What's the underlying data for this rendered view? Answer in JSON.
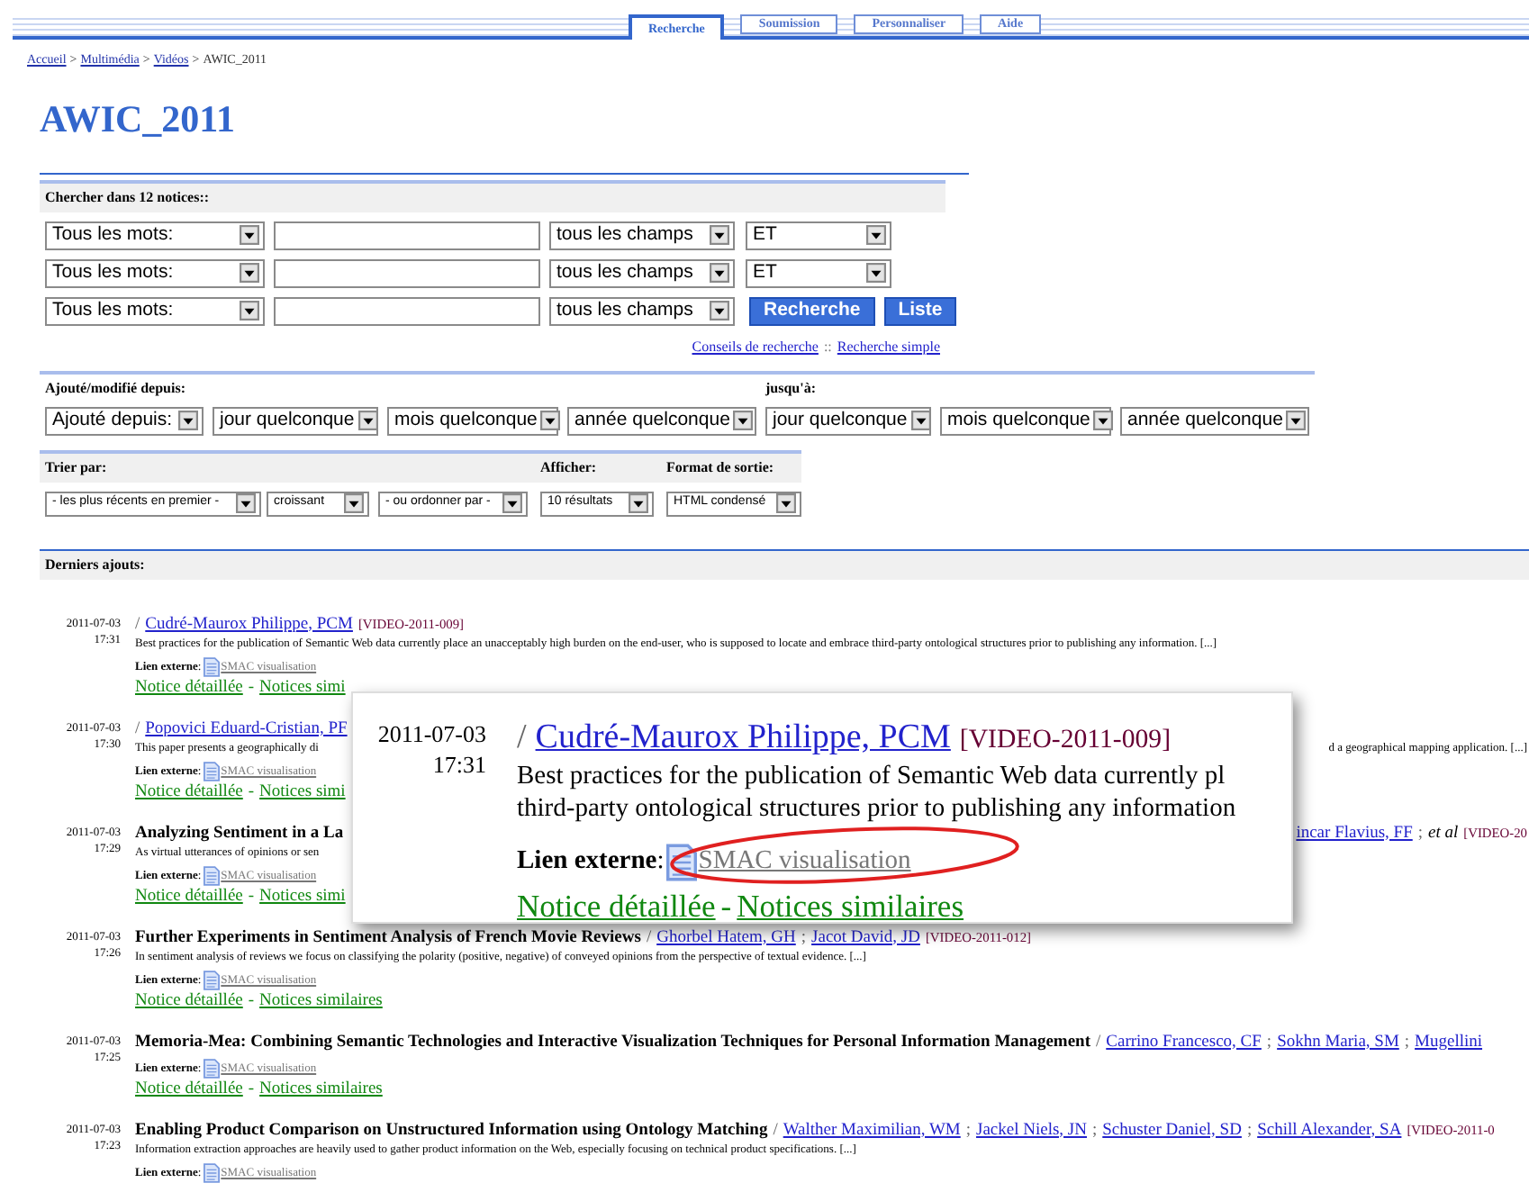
{
  "tabs": [
    {
      "label": "Recherche",
      "selected": true
    },
    {
      "label": "Soumission",
      "selected": false
    },
    {
      "label": "Personnaliser",
      "selected": false
    },
    {
      "label": "Aide",
      "selected": false
    }
  ],
  "breadcrumb": [
    {
      "text": "Accueil",
      "kind": "link"
    },
    {
      "text": ">",
      "kind": "plain"
    },
    {
      "text": "Multimédia",
      "kind": "link"
    },
    {
      "text": ">",
      "kind": "plain"
    },
    {
      "text": "Vidéos",
      "kind": "link"
    },
    {
      "text": ">",
      "kind": "plain"
    },
    {
      "text": "AWIC_2011",
      "kind": "plain"
    }
  ],
  "title": "AWIC_2011",
  "search": {
    "heading": "Chercher dans 12 notices::",
    "rows": [
      {
        "mode": "Tous les mots:",
        "field": "tous les champs",
        "operator": "ET"
      },
      {
        "mode": "Tous les mots:",
        "field": "tous les champs",
        "operator": "ET"
      },
      {
        "mode": "Tous les mots:",
        "field": "tous les champs"
      }
    ],
    "buttons": [
      "Recherche",
      "Liste"
    ],
    "links": [
      {
        "text": "Conseils de recherche",
        "kind": "link"
      },
      {
        "text": "::",
        "kind": "plain"
      },
      {
        "text": "Recherche simple",
        "kind": "link"
      }
    ]
  },
  "date_filter": {
    "from_heading": "Ajouté/modifié depuis:",
    "until_heading": "jusqu'à:",
    "from": [
      "Ajouté depuis:",
      "jour quelconque",
      "mois quelconque",
      "année quelconque"
    ],
    "until": [
      "jour quelconque",
      "mois quelconque",
      "année quelconque"
    ]
  },
  "sort": {
    "sort_heading": "Trier par:",
    "sort_selects": [
      "- les plus récents en premier -",
      "croissant",
      "- ou ordonner par -"
    ],
    "display_heading": "Afficher:",
    "display": "10 résultats",
    "format_heading": "Format de sortie:",
    "format": "HTML condensé"
  },
  "recent": {
    "heading": "Derniers ajouts:",
    "records": [
      {
        "date": "2011-07-03",
        "time": "17:31",
        "heading": [
          {
            "text": "/",
            "kind": "plain"
          },
          {
            "text": "Cudré-Maurox Philippe, PCM",
            "kind": "link"
          },
          {
            "text": "[VIDEO-2011-009]",
            "kind": "report"
          }
        ],
        "abstract": "Best practices for the publication of Semantic Web data currently place an unacceptably high burden on the end-user, who is supposed to locate and embrace third-party ontological structures prior to publishing any information. [...]",
        "link_label": "**Lien externe**:",
        "link": "SMAC visualisation",
        "actions": [
          {
            "text": "Notice détaillée",
            "kind": "link"
          },
          {
            "text": "-",
            "kind": "plain"
          },
          {
            "text": "Notices simi",
            "kind": "link"
          }
        ]
      },
      {
        "date": "2011-07-03",
        "time": "17:30",
        "heading": [
          {
            "text": "/",
            "kind": "plain"
          },
          {
            "text": "Popovici Eduard-Cristian, PF",
            "kind": "link"
          }
        ],
        "abstract": "This paper presents a geographically di",
        "abstract_right": "d a geographical mapping application. [...]",
        "link_label": "**Lien externe**:",
        "link": "SMAC visualisation",
        "actions": [
          {
            "text": "Notice détaillée",
            "kind": "link"
          },
          {
            "text": "-",
            "kind": "plain"
          },
          {
            "text": "Notices simi",
            "kind": "link"
          }
        ]
      },
      {
        "date": "2011-07-03",
        "time": "17:29",
        "heading": [
          {
            "text": "Analyzing Sentiment in a La",
            "kind": "title"
          }
        ],
        "heading_right": [
          {
            "text": "incar Flavius, FF",
            "kind": "link"
          },
          {
            "text": ";",
            "kind": "plain"
          },
          {
            "text": "et al",
            "kind": "etal"
          },
          {
            "text": "[VIDEO-20",
            "kind": "report"
          }
        ],
        "abstract": "As virtual utterances of opinions or sen",
        "link_label": "**Lien externe**:",
        "link": "SMAC visualisation",
        "actions": [
          {
            "text": "Notice détaillée",
            "kind": "link"
          },
          {
            "text": "-",
            "kind": "plain"
          },
          {
            "text": "Notices simi",
            "kind": "link"
          }
        ]
      },
      {
        "date": "2011-07-03",
        "time": "17:26",
        "heading": [
          {
            "text": "Further Experiments in Sentiment Analysis of French Movie Reviews",
            "kind": "title"
          },
          {
            "text": "/",
            "kind": "plain"
          },
          {
            "text": "Ghorbel Hatem, GH",
            "kind": "link"
          },
          {
            "text": ";",
            "kind": "plain"
          },
          {
            "text": "Jacot David, JD",
            "kind": "link"
          },
          {
            "text": "[VIDEO-2011-012]",
            "kind": "report"
          }
        ],
        "abstract": "In sentiment analysis of reviews we focus on classifying the polarity (positive, negative) of conveyed opinions from the perspective of textual evidence. [...]",
        "link_label": "**Lien externe**:",
        "link": "SMAC visualisation",
        "actions": [
          {
            "text": "Notice détaillée",
            "kind": "link"
          },
          {
            "text": "-",
            "kind": "plain"
          },
          {
            "text": "Notices similaires",
            "kind": "link"
          }
        ]
      },
      {
        "date": "2011-07-03",
        "time": "17:25",
        "heading": [
          {
            "text": "Memoria-Mea: Combining Semantic Technologies and Interactive Visualization Techniques for Personal Information Management",
            "kind": "title"
          },
          {
            "text": "/",
            "kind": "plain"
          },
          {
            "text": "Carrino Francesco, CF",
            "kind": "link"
          },
          {
            "text": ";",
            "kind": "plain"
          },
          {
            "text": "Sokhn Maria, SM",
            "kind": "link"
          },
          {
            "text": ";",
            "kind": "plain"
          },
          {
            "text": "Mugellini",
            "kind": "link"
          }
        ],
        "link_label": "**Lien externe**:",
        "link": "SMAC visualisation",
        "actions": [
          {
            "text": "Notice détaillée",
            "kind": "link"
          },
          {
            "text": "-",
            "kind": "plain"
          },
          {
            "text": "Notices similaires",
            "kind": "link"
          }
        ]
      },
      {
        "date": "2011-07-03",
        "time": "17:23",
        "heading": [
          {
            "text": "Enabling Product Comparison on Unstructured Information using Ontology Matching",
            "kind": "title"
          },
          {
            "text": "/",
            "kind": "plain"
          },
          {
            "text": "Walther Maximilian, WM",
            "kind": "link"
          },
          {
            "text": ";",
            "kind": "plain"
          },
          {
            "text": "Jackel Niels, JN",
            "kind": "link"
          },
          {
            "text": ";",
            "kind": "plain"
          },
          {
            "text": "Schuster Daniel, SD",
            "kind": "link"
          },
          {
            "text": ";",
            "kind": "plain"
          },
          {
            "text": "Schill Alexander, SA",
            "kind": "link"
          },
          {
            "text": "[VIDEO-2011-0",
            "kind": "report"
          }
        ],
        "abstract": "Information extraction approaches are heavily used to gather product information on the Web, especially focusing on technical product specifications. [...]",
        "link_label": "**Lien externe**:",
        "link": "SMAC visualisation"
      }
    ]
  },
  "callout": {
    "date": "2011-07-03",
    "time": "17:31",
    "heading": [
      {
        "text": "/",
        "kind": "plain"
      },
      {
        "text": "Cudré-Maurox Philippe, PCM",
        "kind": "link"
      },
      {
        "text": "[VIDEO-2011-009]",
        "kind": "report"
      }
    ],
    "abstract_lines": [
      "Best practices for the publication of Semantic Web data currently pl",
      "third-party ontological structures prior to publishing any information"
    ],
    "link_label": "**Lien externe**:",
    "link": "SMAC visualisation",
    "actions": [
      {
        "text": "Notice détaillée",
        "kind": "link"
      },
      {
        "text": "-",
        "kind": "plain"
      },
      {
        "text": "Notices similaires",
        "kind": "link"
      }
    ]
  }
}
